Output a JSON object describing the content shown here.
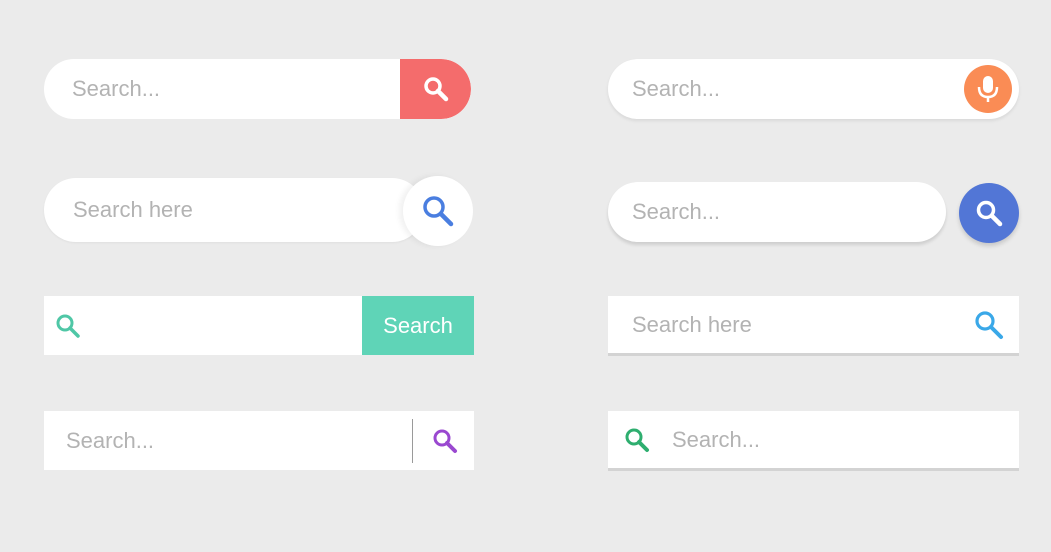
{
  "colors": {
    "background": "#ebebeb",
    "red_button": "#f46c6c",
    "teal_button": "#5fd4b7",
    "orange_mic": "#fa8c55",
    "blue_circle": "#5276d6",
    "icon_blue": "#4a7ee0",
    "icon_teal": "#4fc7a6",
    "icon_purple": "#9a48d0",
    "icon_light_blue": "#3aa8e8",
    "icon_green": "#2eae6f",
    "placeholder_gray": "#b3b3b3"
  },
  "bars": {
    "b1": {
      "placeholder": "Search...",
      "button_icon": "search-icon"
    },
    "b2": {
      "placeholder": "Search here",
      "button_icon": "search-icon"
    },
    "b3": {
      "left_icon": "search-icon",
      "button_label": "Search"
    },
    "b4": {
      "placeholder": "Search...",
      "right_icon": "search-icon"
    },
    "b5": {
      "placeholder": "Search...",
      "button_icon": "microphone-icon"
    },
    "b6": {
      "placeholder": "Search...",
      "button_icon": "search-icon"
    },
    "b7": {
      "placeholder": "Search here",
      "right_icon": "search-icon"
    },
    "b8": {
      "left_icon": "search-icon",
      "placeholder": "Search..."
    }
  }
}
